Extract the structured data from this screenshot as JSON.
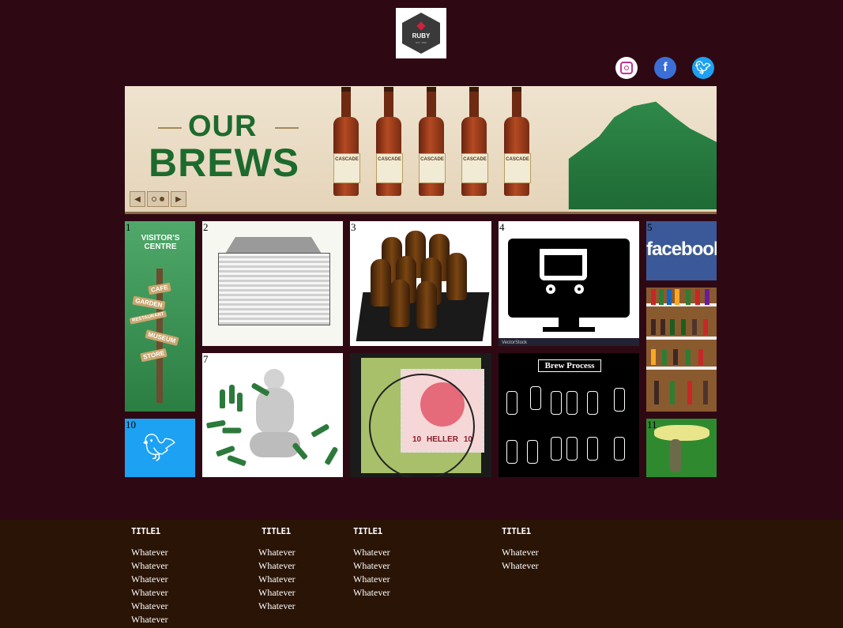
{
  "header": {
    "logo_name": "RUBY",
    "logo_tagline": "EST. 1999",
    "social": [
      {
        "name": "instagram",
        "icon": "instagram-icon",
        "color": "#ffffff"
      },
      {
        "name": "facebook",
        "icon": "facebook-icon",
        "color": "#3b6fd6"
      },
      {
        "name": "twitter",
        "icon": "twitter-icon",
        "color": "#1da1f2"
      }
    ]
  },
  "banner": {
    "line1": "OUR",
    "line2": "BREWS",
    "bottle_label": "CASCADE",
    "slides": 2,
    "active_slide": 2
  },
  "tiles": {
    "t1": {
      "num": "1",
      "text": "VISITOR'S CENTRE",
      "signs": [
        "CAFE",
        "GARDEN",
        "RESTAURANT",
        "MUSEUM",
        "STORE"
      ]
    },
    "t2": {
      "num": "2"
    },
    "t3": {
      "num": "3"
    },
    "t4": {
      "num": "4",
      "credit": "VectorStock"
    },
    "t5": {
      "num": "5",
      "text": "facebook"
    },
    "t7": {
      "num": "7"
    },
    "t8": {
      "stamp_value": "10",
      "stamp_unit": "HELLER"
    },
    "t9": {
      "title": "Brew Process"
    },
    "t10": {
      "num": "10"
    },
    "t11": {
      "num": "11"
    }
  },
  "footer": {
    "columns": [
      {
        "title": "TITLE1",
        "items": [
          "Whatever",
          "Whatever",
          "Whatever",
          "Whatever",
          "Whatever",
          "Whatever"
        ]
      },
      {
        "title": "TITLE1",
        "items": [
          "Whatever",
          "Whatever",
          "Whatever",
          "Whatever",
          "Whatever"
        ]
      },
      {
        "title": "TITLE1",
        "items": [
          "Whatever",
          "Whatever",
          "Whatever",
          "Whatever"
        ]
      },
      {
        "title": "TITLE1",
        "items": [
          "Whatever",
          "Whatever"
        ]
      }
    ]
  },
  "colors": {
    "page_bg": "#2e0914",
    "footer_bg": "#2a1405",
    "brand_green": "#1d6a2e"
  }
}
